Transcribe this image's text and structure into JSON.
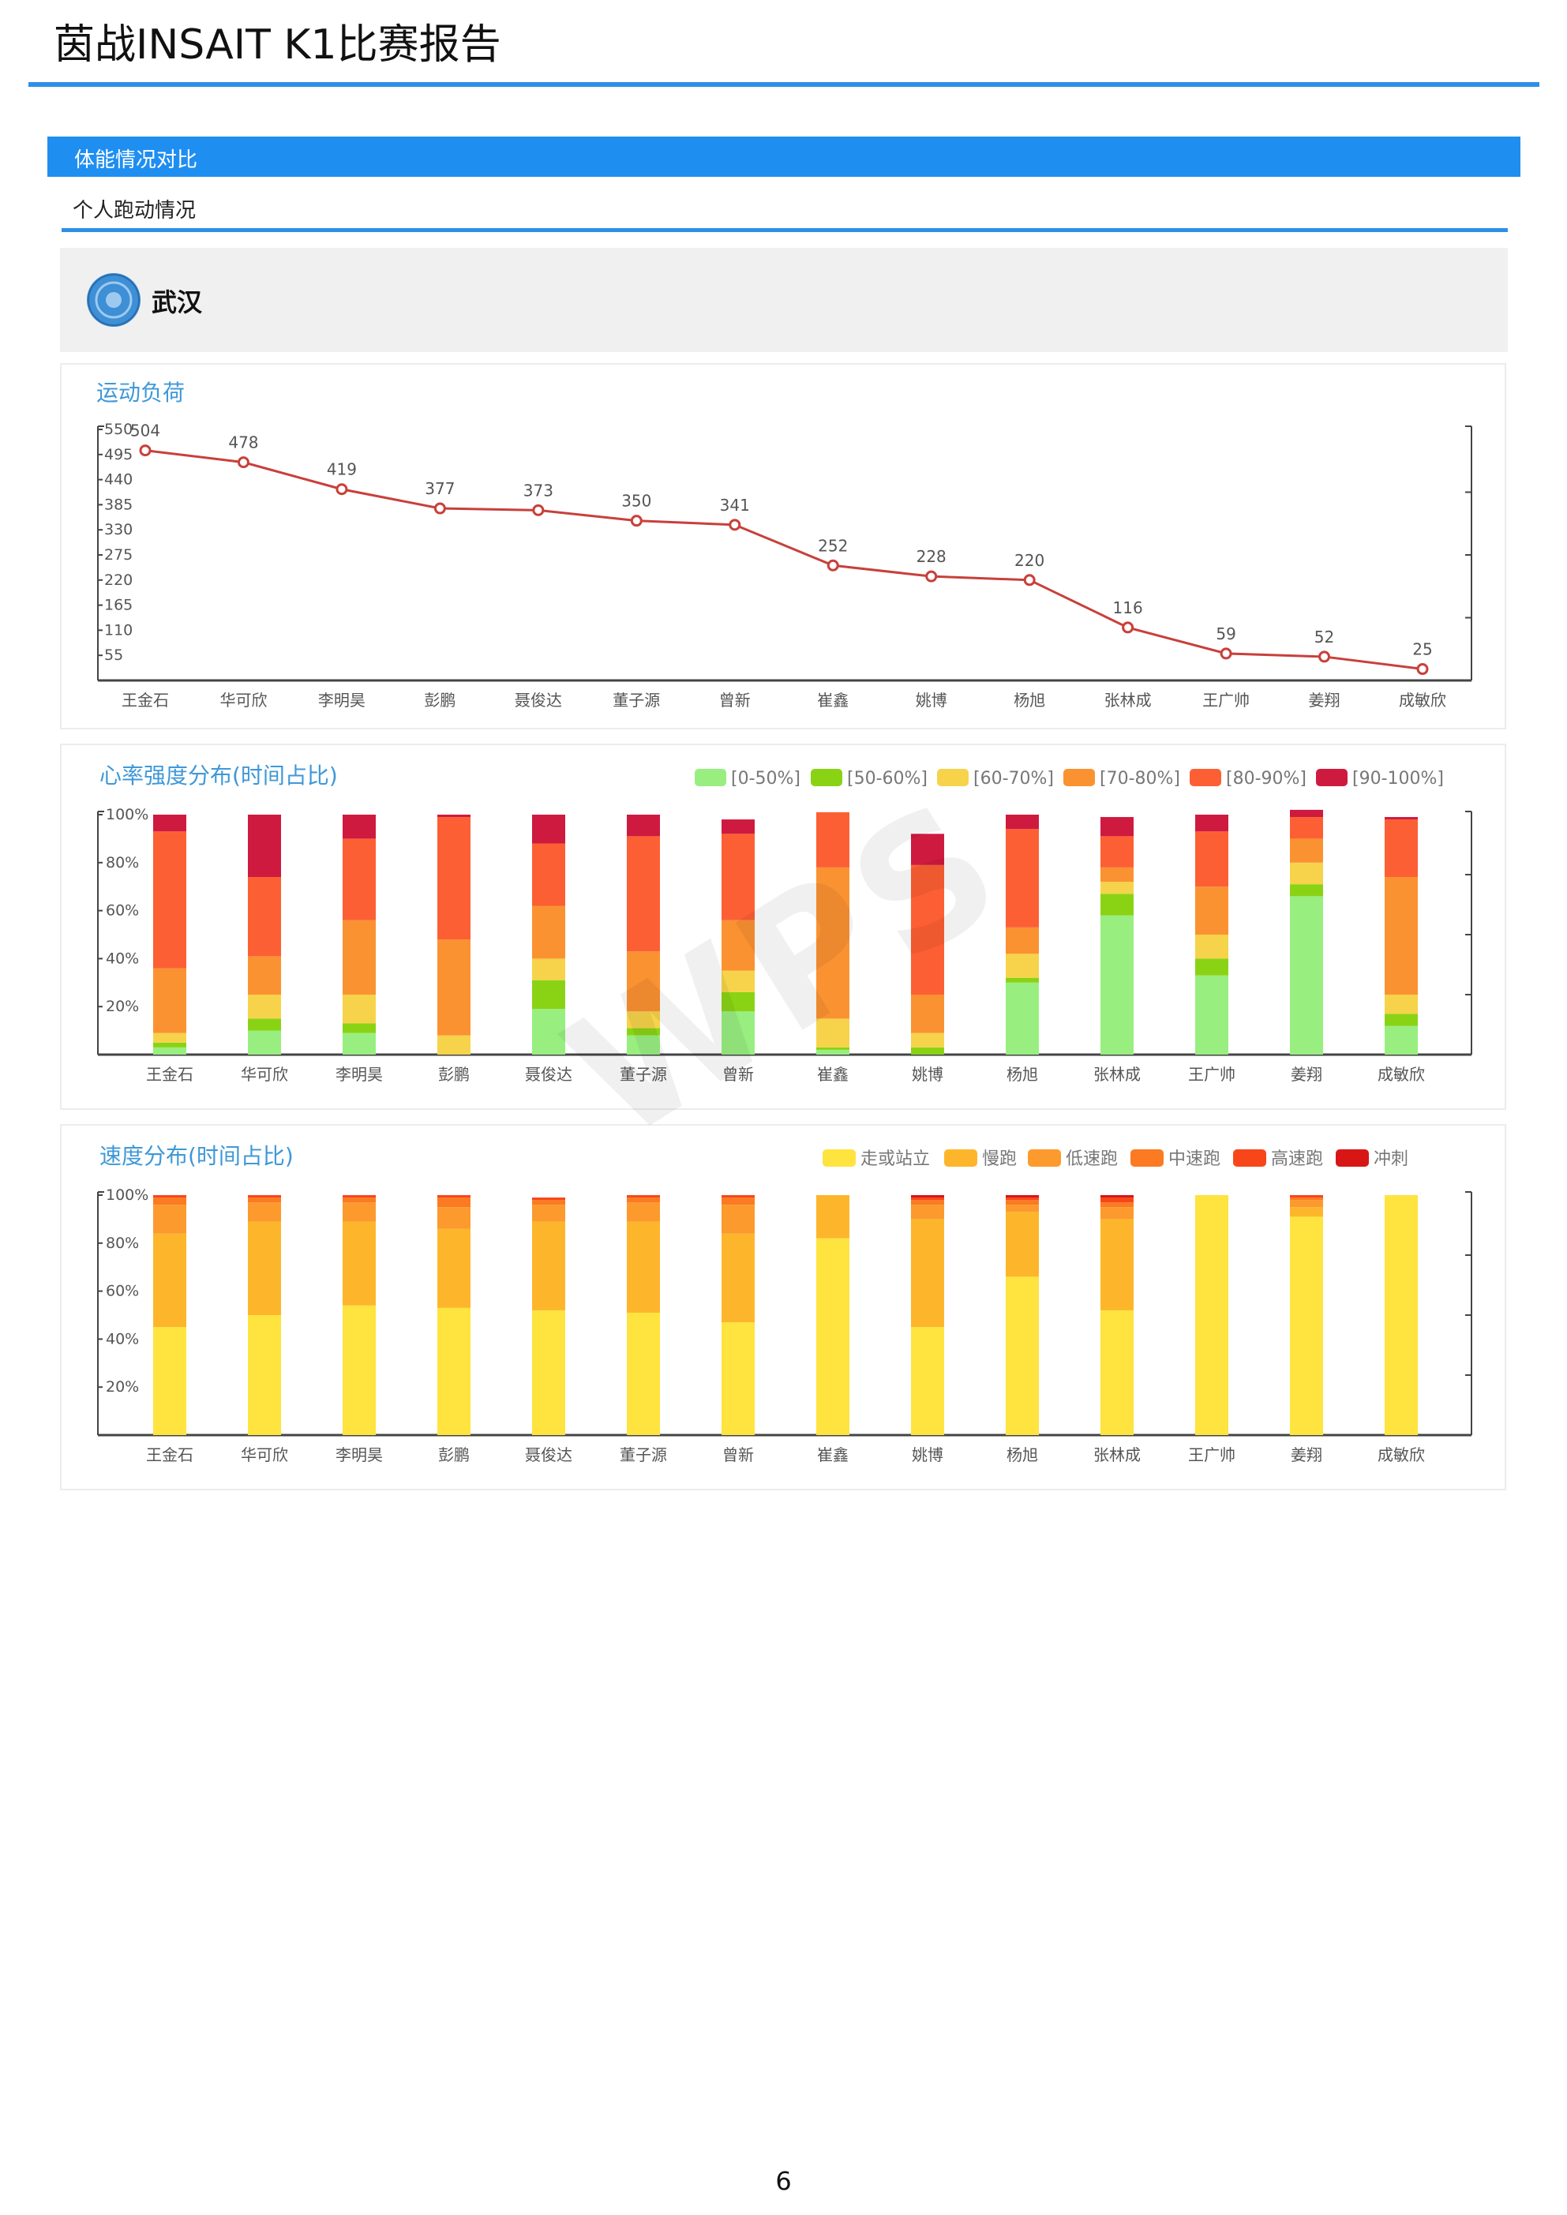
{
  "document": {
    "title": "茵战INSAIT K1比赛报告",
    "page_number": "6"
  },
  "section": {
    "title": "体能情况对比",
    "subtitle": "个人跑动情况"
  },
  "team": {
    "name": "武汉"
  },
  "colors": {
    "accent": "#1f8ef1",
    "line": "#c8403b"
  },
  "chart_data": [
    {
      "type": "line",
      "title": "运动负荷",
      "categories": [
        "王金石",
        "华可欣",
        "李明昊",
        "彭鹏",
        "聂俊达",
        "董子源",
        "曾新",
        "崔鑫",
        "姚博",
        "杨旭",
        "张林成",
        "王广帅",
        "姜翔",
        "成敏欣"
      ],
      "series": [
        {
          "values": [
            504,
            478,
            419,
            377,
            373,
            350,
            341,
            252,
            228,
            220,
            116,
            59,
            52,
            25
          ],
          "color": "#c8403b"
        }
      ],
      "ylim": [
        0,
        550
      ],
      "yticks": [
        550,
        495,
        440,
        385,
        330,
        275,
        220,
        165,
        110,
        55
      ]
    },
    {
      "type": "bar",
      "stacked": true,
      "title": "心率强度分布(时间占比)",
      "categories": [
        "王金石",
        "华可欣",
        "李明昊",
        "彭鹏",
        "聂俊达",
        "董子源",
        "曾新",
        "崔鑫",
        "姚博",
        "杨旭",
        "张林成",
        "王广帅",
        "姜翔",
        "成敏欣"
      ],
      "ylim": [
        0,
        100
      ],
      "yticks": [
        "100%",
        "80%",
        "60%",
        "40%",
        "20%"
      ],
      "series": [
        {
          "name": "[0-50%]",
          "color": "#98ef80",
          "values": [
            3,
            10,
            9,
            0,
            19,
            8,
            18,
            2,
            0,
            30,
            58,
            33,
            66,
            12
          ]
        },
        {
          "name": "[50-60%]",
          "color": "#8ad314",
          "values": [
            2,
            5,
            4,
            0,
            12,
            3,
            8,
            1,
            3,
            2,
            9,
            7,
            5,
            5
          ]
        },
        {
          "name": "[60-70%]",
          "color": "#f6d34a",
          "values": [
            4,
            10,
            12,
            8,
            9,
            7,
            9,
            12,
            6,
            10,
            5,
            10,
            9,
            8
          ]
        },
        {
          "name": "[70-80%]",
          "color": "#fb9232",
          "values": [
            27,
            16,
            31,
            40,
            22,
            25,
            21,
            63,
            16,
            11,
            6,
            20,
            10,
            49
          ]
        },
        {
          "name": "[80-90%]",
          "color": "#fd5f34",
          "values": [
            57,
            33,
            34,
            51,
            26,
            48,
            36,
            23,
            54,
            41,
            13,
            23,
            9,
            24
          ]
        },
        {
          "name": "[90-100%]",
          "color": "#cf1a3f",
          "values": [
            7,
            26,
            10,
            1,
            12,
            9,
            6,
            0,
            13,
            6,
            8,
            7,
            3,
            1
          ]
        }
      ]
    },
    {
      "type": "bar",
      "stacked": true,
      "title": "速度分布(时间占比)",
      "categories": [
        "王金石",
        "华可欣",
        "李明昊",
        "彭鹏",
        "聂俊达",
        "董子源",
        "曾新",
        "崔鑫",
        "姚博",
        "杨旭",
        "张林成",
        "王广帅",
        "姜翔",
        "成敏欣"
      ],
      "ylim": [
        0,
        100
      ],
      "yticks": [
        "100%",
        "80%",
        "60%",
        "40%",
        "20%"
      ],
      "series": [
        {
          "name": "走或站立",
          "color": "#ffe33f",
          "values": [
            45,
            50,
            54,
            53,
            52,
            51,
            47,
            82,
            45,
            66,
            52,
            100,
            91,
            100
          ]
        },
        {
          "name": "慢跑",
          "color": "#fdb62b",
          "values": [
            39,
            39,
            35,
            33,
            37,
            38,
            37,
            18,
            45,
            27,
            38,
            0,
            4,
            0
          ]
        },
        {
          "name": "低速跑",
          "color": "#fc9a2e",
          "values": [
            12,
            8,
            8,
            9,
            7,
            8,
            12,
            0,
            6,
            3,
            5,
            0,
            3,
            0
          ]
        },
        {
          "name": "中速跑",
          "color": "#fc7a22",
          "values": [
            3,
            2,
            2,
            4,
            2,
            2,
            3,
            0,
            2,
            2,
            2,
            0,
            1,
            0
          ]
        },
        {
          "name": "高速跑",
          "color": "#f7471a",
          "values": [
            1,
            1,
            1,
            1,
            1,
            1,
            1,
            0,
            1,
            1,
            2,
            0,
            1,
            0
          ]
        },
        {
          "name": "冲刺",
          "color": "#d91616",
          "values": [
            0,
            0,
            0,
            0,
            0,
            0,
            0,
            0,
            1,
            1,
            1,
            0,
            0,
            0
          ]
        }
      ]
    }
  ]
}
